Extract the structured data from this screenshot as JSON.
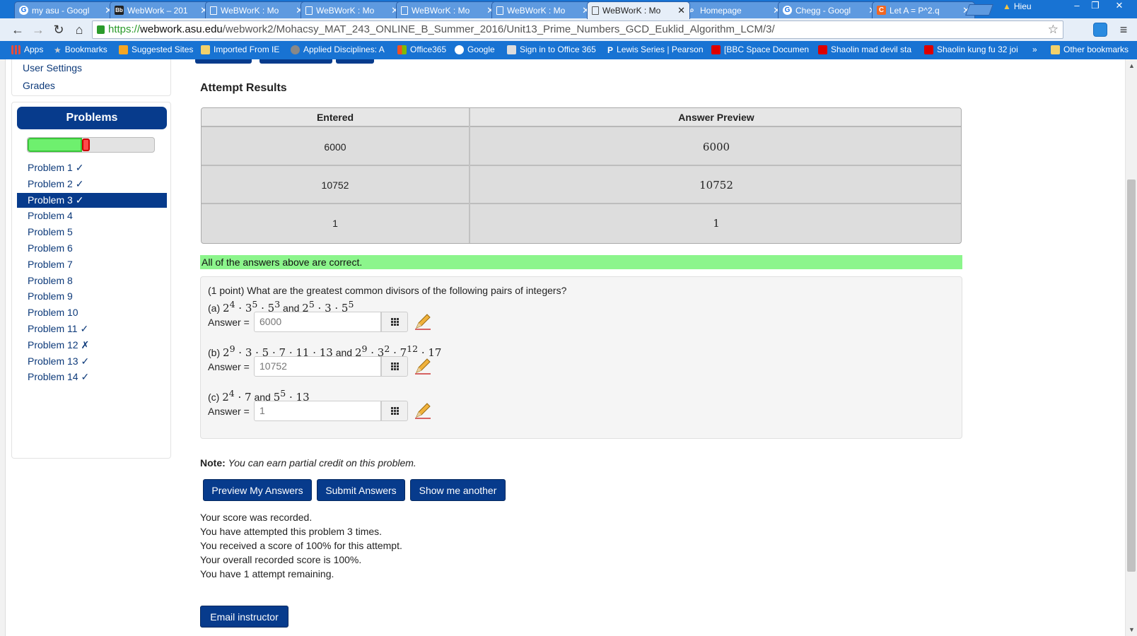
{
  "browser": {
    "tabs": [
      {
        "label": "my asu - Googl",
        "favicon": "google-icon"
      },
      {
        "label": "WebWork – 201",
        "favicon": "blackboard-icon"
      },
      {
        "label": "WeBWorK : Mo",
        "favicon": "page-icon"
      },
      {
        "label": "WeBWorK : Mo",
        "favicon": "page-icon"
      },
      {
        "label": "WeBWorK : Mo",
        "favicon": "page-icon"
      },
      {
        "label": "WeBWorK : Mo",
        "favicon": "page-icon"
      },
      {
        "label": "WeBWorK : Mo",
        "favicon": "page-icon",
        "active": true
      },
      {
        "label": "Homepage",
        "favicon": "search-icon"
      },
      {
        "label": "Chegg - Googl",
        "favicon": "google-icon"
      },
      {
        "label": "Let A = P^2.q",
        "favicon": "chegg-icon"
      }
    ],
    "profile_name": "Hieu",
    "url": {
      "scheme": "https://",
      "host": "webwork.asu.edu",
      "path": "/webwork2/Mohacsy_MAT_243_ONLINE_B_Summer_2016/Unit13_Prime_Numbers_GCD_Euklid_Algorithm_LCM/3/"
    },
    "bookmarks": [
      "Apps",
      "Bookmarks",
      "Suggested Sites",
      "Imported From IE",
      "Applied Disciplines: A",
      "Office365",
      "Google",
      "Sign in to Office 365",
      "Lewis Series | Pearson",
      "[BBC Space Documen",
      "Shaolin mad devil sta",
      "Shaolin kung fu 32 joi",
      "»",
      "Other bookmarks"
    ]
  },
  "sidebar": {
    "links": [
      "User Settings",
      "Grades"
    ],
    "problems_title": "Problems",
    "progress_fraction": 0.5,
    "problems": [
      {
        "label": "Problem 1 ✓"
      },
      {
        "label": "Problem 2 ✓"
      },
      {
        "label": "Problem 3 ✓",
        "active": true
      },
      {
        "label": "Problem 4"
      },
      {
        "label": "Problem 5"
      },
      {
        "label": "Problem 6"
      },
      {
        "label": "Problem 7"
      },
      {
        "label": "Problem 8"
      },
      {
        "label": "Problem 9"
      },
      {
        "label": "Problem 10"
      },
      {
        "label": "Problem 11 ✓"
      },
      {
        "label": "Problem 12 ✗"
      },
      {
        "label": "Problem 13 ✓"
      },
      {
        "label": "Problem 14 ✓"
      }
    ]
  },
  "attempt": {
    "title": "Attempt Results",
    "columns": [
      "Entered",
      "Answer Preview"
    ],
    "rows": [
      {
        "entered": "6000",
        "preview": "6000"
      },
      {
        "entered": "10752",
        "preview": "10752"
      },
      {
        "entered": "1",
        "preview": "1"
      }
    ],
    "banner": "All of the answers above are correct."
  },
  "problem": {
    "question": "(1 point) What are the greatest common divisors of the following pairs of integers?",
    "answer_label": "Answer =",
    "parts": [
      {
        "prefix": "(a)",
        "answer": "6000"
      },
      {
        "prefix": "(b)",
        "answer": "10752"
      },
      {
        "prefix": "(c)",
        "answer": "1"
      }
    ]
  },
  "note": {
    "label": "Note:",
    "text": "You can earn partial credit on this problem."
  },
  "buttons": {
    "preview": "Preview My Answers",
    "submit": "Submit Answers",
    "another": "Show me another",
    "email": "Email instructor"
  },
  "score_lines": [
    "Your score was recorded.",
    "You have attempted this problem 3 times.",
    "You received a score of 100% for this attempt.",
    "Your overall recorded score is 100%.",
    "You have 1 attempt remaining."
  ],
  "colors": {
    "chrome_blue": "#1873d3",
    "webwork_navy": "#073b8c",
    "correct_green": "#8cf58c"
  }
}
